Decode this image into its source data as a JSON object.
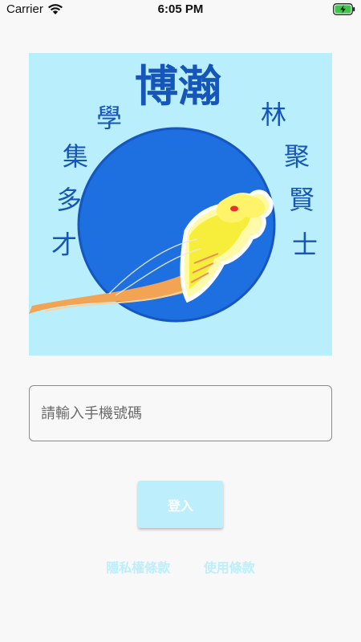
{
  "status_bar": {
    "carrier": "Carrier",
    "time": "6:05 PM",
    "wifi_icon": "wifi-icon",
    "battery_icon": "battery-charging-icon"
  },
  "logo": {
    "title": "博瀚",
    "left_text": [
      "學",
      "集",
      "多",
      "才"
    ],
    "right_text": [
      "林",
      "聚",
      "賢",
      "士"
    ],
    "background_color": "#b9effc",
    "circle_color": "#1e6fe0",
    "text_color": "#1656b8"
  },
  "login": {
    "phone_placeholder": "請輸入手機號碼",
    "phone_value": "",
    "login_label": "登入",
    "button_color": "#bdeefb"
  },
  "footer": {
    "privacy_label": "隱私權條款",
    "terms_label": "使用條款"
  }
}
